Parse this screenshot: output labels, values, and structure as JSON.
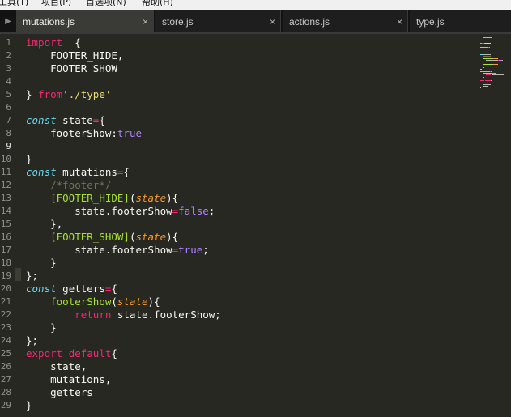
{
  "menubar": {
    "items": [
      "工具(T)",
      "项目(P)",
      "首选项(N)",
      "帮助(H)"
    ]
  },
  "tabs": [
    {
      "label": "mutations.js",
      "active": true,
      "close": "×"
    },
    {
      "label": "store.js",
      "active": false,
      "close": "×"
    },
    {
      "label": "actions.js",
      "active": false,
      "close": "×"
    },
    {
      "label": "type.js",
      "active": false,
      "close": ""
    }
  ],
  "tab_scroll_icon": "▶",
  "editor": {
    "current_line": 9,
    "line_numbers": [
      "1",
      "2",
      "3",
      "4",
      "5",
      "6",
      "7",
      "8",
      "9",
      "10",
      "11",
      "12",
      "13",
      "14",
      "15",
      "16",
      "17",
      "18",
      "19",
      "20",
      "21",
      "22",
      "23",
      "24",
      "25",
      "26",
      "27",
      "28",
      "29"
    ],
    "lines": [
      [
        [
          "kw",
          "import"
        ],
        [
          "",
          "  {"
        ]
      ],
      [
        [
          "",
          "    FOOTER_HIDE,"
        ]
      ],
      [
        [
          "",
          "    FOOTER_SHOW"
        ]
      ],
      [],
      [
        [
          "",
          "} "
        ],
        [
          "kw",
          "from"
        ],
        [
          "",
          "",
          " "
        ],
        [
          "str",
          "'./type'"
        ]
      ],
      [],
      [
        [
          "st",
          "const"
        ],
        [
          "",
          " state"
        ],
        [
          "kw",
          "="
        ],
        [
          "",
          "{"
        ]
      ],
      [
        [
          "",
          "    footerShow:"
        ],
        [
          "bool",
          "true"
        ]
      ],
      [],
      [
        [
          "",
          "}"
        ]
      ],
      [
        [
          "st",
          "const"
        ],
        [
          "",
          " mutations"
        ],
        [
          "kw",
          "="
        ],
        [
          "",
          "{"
        ]
      ],
      [
        [
          "cm",
          "    /*footer*/"
        ]
      ],
      [
        [
          "",
          "    "
        ],
        [
          "fn",
          "[FOOTER_HIDE]"
        ],
        [
          "",
          "("
        ],
        [
          "param",
          "state"
        ],
        [
          "",
          "){"
        ]
      ],
      [
        [
          "",
          "        state.footerShow"
        ],
        [
          "kw",
          "="
        ],
        [
          "bool",
          "false"
        ],
        [
          "",
          ";"
        ]
      ],
      [
        [
          "",
          "    },"
        ]
      ],
      [
        [
          "",
          "    "
        ],
        [
          "fn",
          "[FOOTER_SHOW]"
        ],
        [
          "",
          "("
        ],
        [
          "param",
          "state"
        ],
        [
          "",
          "){"
        ]
      ],
      [
        [
          "",
          "        state.footerShow"
        ],
        [
          "kw",
          "="
        ],
        [
          "bool",
          "true"
        ],
        [
          "",
          ";"
        ]
      ],
      [
        [
          "",
          "    }"
        ]
      ],
      [
        [
          "",
          "};"
        ]
      ],
      [
        [
          "st",
          "const"
        ],
        [
          "",
          " getters"
        ],
        [
          "kw",
          "="
        ],
        [
          "",
          "{"
        ]
      ],
      [
        [
          "",
          "    "
        ],
        [
          "fn",
          "footerShow"
        ],
        [
          "",
          "("
        ],
        [
          "param",
          "state"
        ],
        [
          "",
          "){"
        ]
      ],
      [
        [
          "",
          "        "
        ],
        [
          "kw",
          "return"
        ],
        [
          "",
          " state.footerShow;"
        ]
      ],
      [
        [
          "",
          "    }"
        ]
      ],
      [
        [
          "",
          "};"
        ]
      ],
      [
        [
          "kw",
          "export"
        ],
        [
          "",
          " "
        ],
        [
          "kw",
          "default"
        ],
        [
          "",
          "{"
        ]
      ],
      [
        [
          "",
          "    state,"
        ]
      ],
      [
        [
          "",
          "    mutations,"
        ]
      ],
      [
        [
          "",
          "    getters"
        ]
      ],
      [
        [
          "",
          "}"
        ]
      ]
    ]
  },
  "colors": {
    "background": "#272822",
    "keyword": "#f92672",
    "storage": "#66d9ef",
    "string": "#e6db74",
    "constant": "#ae81ff",
    "function": "#a6e22e",
    "parameter": "#fd971f",
    "comment": "#75715e"
  }
}
